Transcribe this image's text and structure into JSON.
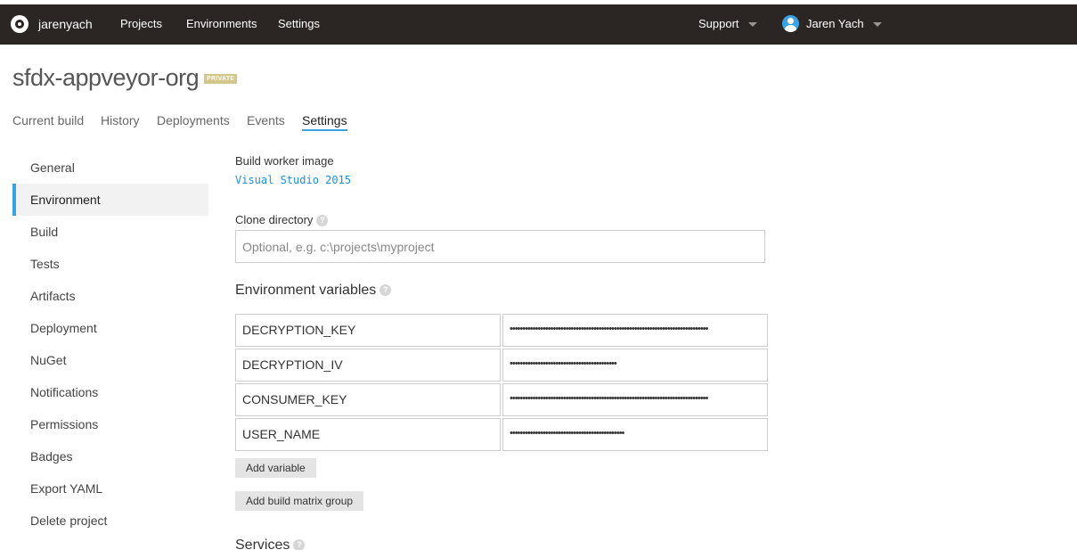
{
  "topbar": {
    "logo_icon": "appveyor-logo-icon",
    "account": "jarenyach",
    "nav": [
      "Projects",
      "Environments",
      "Settings"
    ],
    "support": "Support",
    "user_name": "Jaren Yach",
    "bg_color": "#2b2523"
  },
  "project": {
    "title": "sfdx-appveyor-org",
    "badge": "PRIVATE"
  },
  "tabs": [
    "Current build",
    "History",
    "Deployments",
    "Events",
    "Settings"
  ],
  "active_tab": "Settings",
  "sidebar": {
    "items": [
      "General",
      "Environment",
      "Build",
      "Tests",
      "Artifacts",
      "Deployment",
      "NuGet",
      "Notifications",
      "Permissions",
      "Badges",
      "Export YAML",
      "Delete project"
    ],
    "active": "Environment",
    "accent_color": "#3aa3e3"
  },
  "form": {
    "worker_image_label": "Build worker image",
    "worker_image_value": "Visual Studio 2015",
    "clone_dir_label": "Clone directory",
    "clone_dir_placeholder": "Optional, e.g. c:\\projects\\myproject",
    "clone_dir_value": "",
    "env_vars_heading": "Environment variables",
    "env_vars": [
      {
        "name": "DECRYPTION_KEY",
        "value": "••••••••••••••••••••••••••••••••••••••••••••••••••••••••••••••••••••••••••••••"
      },
      {
        "name": "DECRYPTION_IV",
        "value": "••••••••••••••••••••••••••••••••••••••••••"
      },
      {
        "name": "CONSUMER_KEY",
        "value": "••••••••••••••••••••••••••••••••••••••••••••••••••••••••••••••••••••••••••••••"
      },
      {
        "name": "USER_NAME",
        "value": "•••••••••••••••••••••••••••••••••••••••••••••"
      }
    ],
    "add_variable": "Add variable",
    "add_matrix_group": "Add build matrix group",
    "services_heading": "Services",
    "help_glyph": "?"
  }
}
